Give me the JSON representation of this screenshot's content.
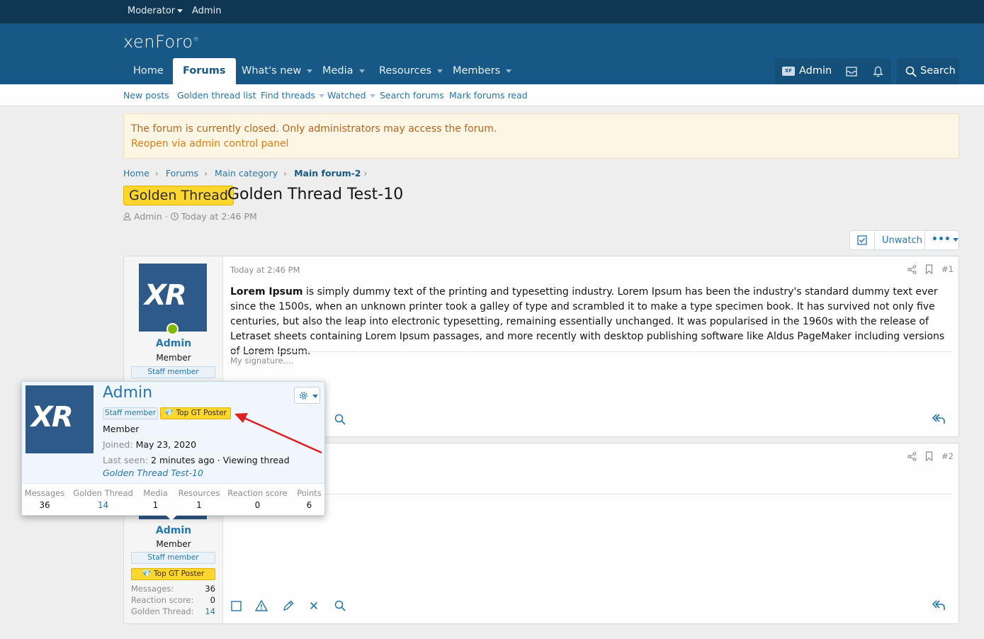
{
  "staff_bar": {
    "moderator": "Moderator",
    "admin": "Admin"
  },
  "header": {
    "logo": "xenForo",
    "tabs": [
      {
        "label": "Home"
      },
      {
        "label": "Forums"
      },
      {
        "label": "What's new"
      },
      {
        "label": "Media"
      },
      {
        "label": "Resources"
      },
      {
        "label": "Members"
      }
    ],
    "user": "Admin",
    "search": "Search"
  },
  "subnav": [
    "New posts",
    "Golden thread list",
    "Find threads",
    "Watched",
    "Search forums",
    "Mark forums read"
  ],
  "notice": {
    "line1": "The forum is currently closed. Only administrators may access the forum.",
    "line2": "Reopen via admin control panel"
  },
  "breadcrumbs": [
    "Home",
    "Forums",
    "Main category",
    "Main forum-2"
  ],
  "thread": {
    "prefix": "Golden Thread",
    "title": "Golden Thread Test-10",
    "author": "Admin",
    "time": "Today at 2:46 PM",
    "unwatch": "Unwatch"
  },
  "post1": {
    "date": "Today at 2:46 PM",
    "number": "#1",
    "body_bold": "Lorem Ipsum",
    "body": " is simply dummy text of the printing and typesetting industry. Lorem Ipsum has been the industry's standard dummy text ever since the 1500s, when an unknown printer took a galley of type and scrambled it to make a type specimen book. It has survived not only five centuries, but also the leap into electronic typesetting, remaining essentially unchanged. It was popularised in the 1960s with the release of Letraset sheets containing Lorem Ipsum passages, and more recently with desktop publishing software like Aldus PageMaker including versions of Lorem Ipsum.",
    "signature": "My signature....",
    "user": {
      "name": "Admin",
      "title": "Member",
      "banner": "Staff member"
    }
  },
  "post2": {
    "number": "#2",
    "user": {
      "name": "Admin",
      "title": "Member",
      "banner": "Staff member",
      "gt_banner": "Top GT Poster",
      "stats": [
        {
          "label": "Messages:",
          "value": "36"
        },
        {
          "label": "Reaction score:",
          "value": "0"
        },
        {
          "label": "Golden Thread:",
          "value": "14"
        }
      ]
    }
  },
  "tooltip": {
    "name": "Admin",
    "staff": "Staff member",
    "gt": "Top GT Poster",
    "title": "Member",
    "joined_label": "Joined:",
    "joined": "May 23, 2020",
    "seen_label": "Last seen:",
    "seen": "2 minutes ago · Viewing thread",
    "seen_link": "Golden Thread Test-10",
    "stats": [
      {
        "label": "Messages",
        "value": "36"
      },
      {
        "label": "Golden Thread",
        "value": "14"
      },
      {
        "label": "Media",
        "value": "1"
      },
      {
        "label": "Resources",
        "value": "1"
      },
      {
        "label": "Reaction score",
        "value": "0"
      },
      {
        "label": "Points",
        "value": "6"
      }
    ]
  },
  "colors": {
    "header": "#185886",
    "staffbar": "#0f3652",
    "link": "#2577b1",
    "gold": "#ffd62e",
    "annotation": "#e02020"
  }
}
